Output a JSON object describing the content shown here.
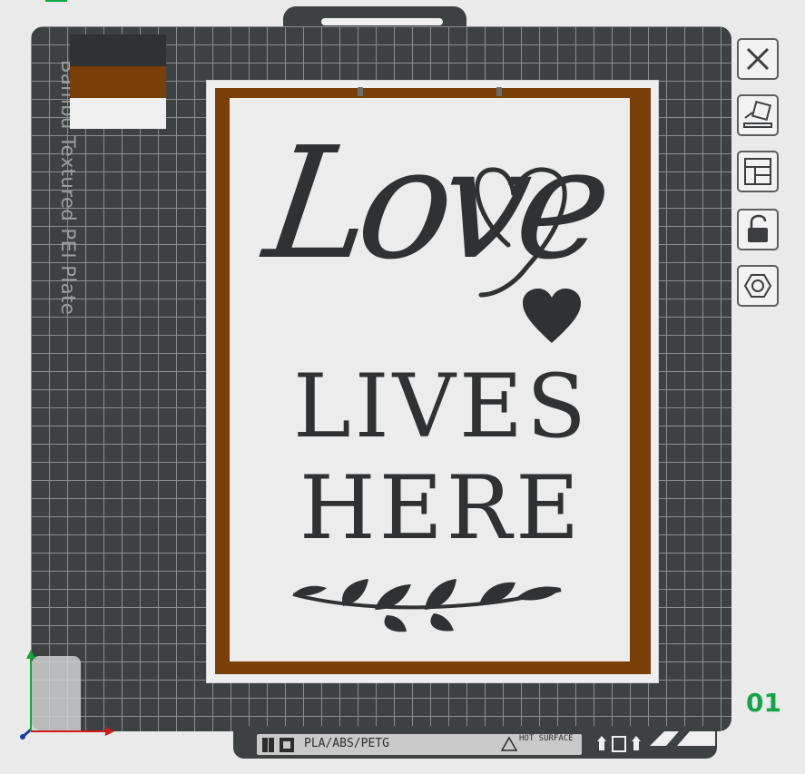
{
  "bed": {
    "plate_label": "Bambu Textured PEI Plate",
    "plate_number": "01",
    "filament_types": "PLA/ABS/PETG",
    "hot_surface": "HOT SURFACE"
  },
  "colors": {
    "bed": "#3e4142",
    "grid": "#8a8d8e",
    "frame": "#7a3e07",
    "panel": "#ececec",
    "text": "#2f3132",
    "swatch_dark": "#2f3132",
    "swatch_brown": "#7a3e07",
    "swatch_white": "#efefef",
    "plate_number": "#14a54a"
  },
  "model": {
    "line1": "Love",
    "line2": "LIVES",
    "line3": "HERE"
  },
  "toolbar": {
    "icons": [
      "close-icon",
      "auto-orient-icon",
      "arrange-icon",
      "lock-icon",
      "settings-icon"
    ]
  }
}
